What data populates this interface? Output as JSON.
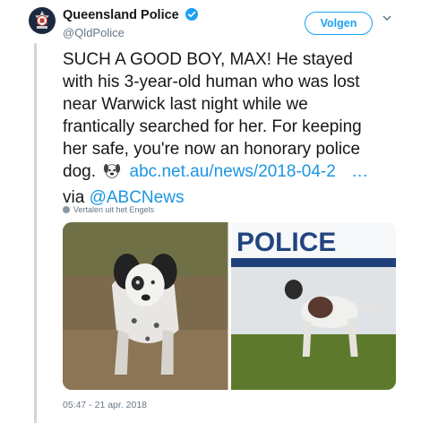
{
  "account": {
    "name": "Queensland Police",
    "handle": "@QldPolice",
    "verified_icon": "verified-badge-icon",
    "avatar_icon": "police-badge-icon"
  },
  "follow_button": "Volgen",
  "tweet": {
    "line1": "SUCH A GOOD BOY, MAX! He stayed",
    "line2": "with his 3-year-old human who was lost",
    "line3": "near Warwick last night while we",
    "line4": "frantically searched for her. For keeping",
    "line5": "her safe, you're now an honorary police",
    "line6_prefix": "dog.",
    "link": "abc.net.au/news/2018-04-2",
    "link_ellipsis": "…",
    "via": "via",
    "mention": "@ABCNews"
  },
  "translate_label": "Vertalen uit het Engels",
  "photo_right_text": "POLICE",
  "timestamp": "05:47 - 21 apr. 2018",
  "colors": {
    "link": "#1b95e0",
    "secondary_text": "#657786",
    "thread_line": "#ccd6dd"
  }
}
